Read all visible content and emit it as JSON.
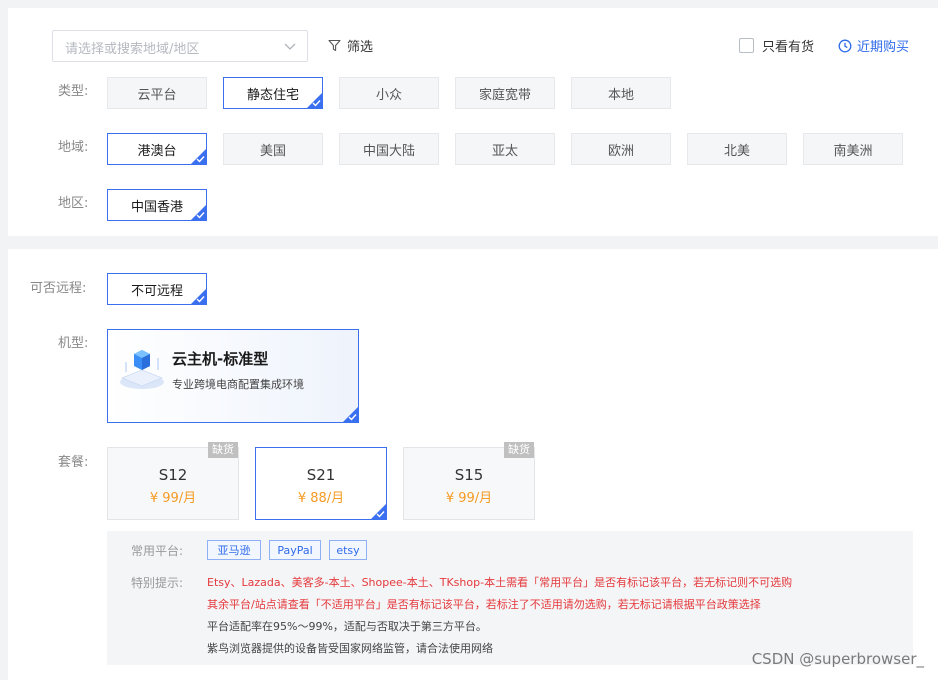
{
  "filter_bar": {
    "search_placeholder": "请选择或搜索地域/地区",
    "filter_label": "筛选",
    "in_stock_label": "只看有货",
    "recent_label": "近期购买"
  },
  "rows": {
    "type": {
      "label": "类型:",
      "options": [
        "云平台",
        "静态住宅",
        "小众",
        "家庭宽带",
        "本地"
      ],
      "selected": "静态住宅"
    },
    "domain": {
      "label": "地域:",
      "options": [
        "港澳台",
        "美国",
        "中国大陆",
        "亚太",
        "欧洲",
        "北美",
        "南美洲"
      ],
      "selected": "港澳台"
    },
    "region": {
      "label": "地区:",
      "options": [
        "中国香港"
      ],
      "selected": "中国香港"
    },
    "remote": {
      "label": "可否远程:",
      "options": [
        "不可远程"
      ],
      "selected": "不可远程"
    }
  },
  "model": {
    "label": "机型:",
    "title": "云主机-标准型",
    "desc": "专业跨境电商配置集成环境"
  },
  "plans": {
    "label": "套餐:",
    "items": [
      {
        "name": "S12",
        "price": "¥ 99/月",
        "badge": "缺货",
        "selected": false
      },
      {
        "name": "S21",
        "price": "¥ 88/月",
        "badge": "",
        "selected": true
      },
      {
        "name": "S15",
        "price": "¥ 99/月",
        "badge": "缺货",
        "selected": false
      }
    ]
  },
  "info": {
    "platforms_label": "常用平台:",
    "platforms": [
      "亚马逊",
      "PayPal",
      "etsy"
    ],
    "notice_label": "特别提示:",
    "notes": [
      "Etsy、Lazada、美客多-本土、Shopee-本土、TKshop-本土需看「常用平台」是否有标记该平台，若无标记则不可选购",
      "其余平台/站点请查看「不适用平台」是否有标记该平台，若标注了不适用请勿选购，若无标记请根据平台政策选择",
      "平台适配率在95%～99%，适配与否取决于第三方平台。",
      "紫鸟浏览器提供的设备皆受国家网络监管，请合法使用网络"
    ]
  },
  "watermark": "CSDN @superbrowser_",
  "colors": {
    "accent": "#3a6ff0",
    "price": "#f59a23",
    "warning": "#e4393c"
  }
}
